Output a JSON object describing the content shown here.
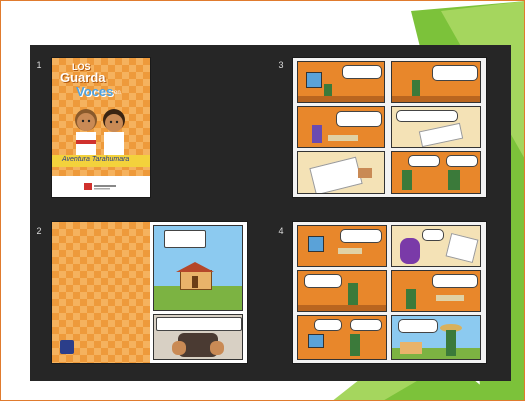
{
  "thumbnails": [
    {
      "number": "1",
      "logo_line1": "LOS",
      "logo_line2": "Guarda",
      "logo_line3": "Voces",
      "logo_suffix": "en",
      "subtitle": "Aventura Tarahumara"
    },
    {
      "number": "2"
    },
    {
      "number": "3"
    },
    {
      "number": "4"
    }
  ],
  "colors": {
    "frame_border": "#e07b2e",
    "viewer_bg": "#262626",
    "accent_green": "#7cc23a",
    "diamond_orange": "#ee9a3b"
  }
}
